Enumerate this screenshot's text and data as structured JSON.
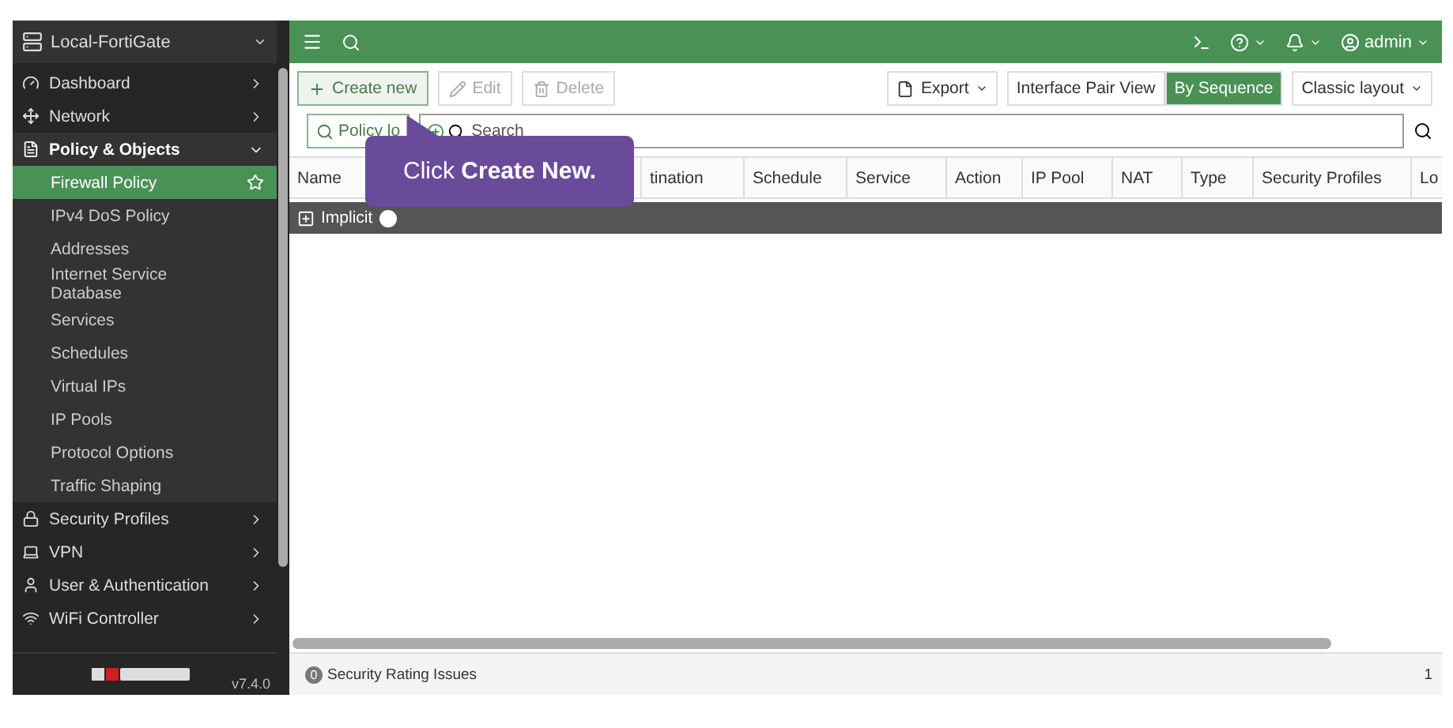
{
  "device": {
    "name": "Local-FortiGate"
  },
  "sidebar": {
    "items": [
      {
        "kind": "section",
        "label": "Dashboard",
        "expanded": false,
        "selected": false
      },
      {
        "kind": "section",
        "label": "Network",
        "expanded": false,
        "selected": false
      },
      {
        "kind": "section",
        "label": "Policy & Objects",
        "expanded": true,
        "selected": true
      },
      {
        "kind": "sub",
        "label": "Firewall Policy",
        "selected": true
      },
      {
        "kind": "sub",
        "label": "IPv4 DoS Policy",
        "selected": false
      },
      {
        "kind": "sub",
        "label": "Addresses",
        "selected": false
      },
      {
        "kind": "sub",
        "label": "Internet Service Database",
        "selected": false
      },
      {
        "kind": "sub",
        "label": "Services",
        "selected": false
      },
      {
        "kind": "sub",
        "label": "Schedules",
        "selected": false
      },
      {
        "kind": "sub",
        "label": "Virtual IPs",
        "selected": false
      },
      {
        "kind": "sub",
        "label": "IP Pools",
        "selected": false
      },
      {
        "kind": "sub",
        "label": "Protocol Options",
        "selected": false
      },
      {
        "kind": "sub",
        "label": "Traffic Shaping",
        "selected": false
      },
      {
        "kind": "section",
        "label": "Security Profiles",
        "expanded": false,
        "selected": false
      },
      {
        "kind": "section",
        "label": "VPN",
        "expanded": false,
        "selected": false
      },
      {
        "kind": "section",
        "label": "User & Authentication",
        "expanded": false,
        "selected": false
      },
      {
        "kind": "section",
        "label": "WiFi Controller",
        "expanded": false,
        "selected": false
      }
    ],
    "version": "v7.4.0"
  },
  "topbar": {
    "user": "admin"
  },
  "toolbar": {
    "buttons": [
      {
        "kind": "create",
        "label": "Create new",
        "disabled": false
      },
      {
        "kind": "edit",
        "label": "Edit",
        "disabled": true
      },
      {
        "kind": "delete",
        "label": "Delete",
        "disabled": true
      }
    ],
    "export": "Export",
    "views": [
      {
        "label": "Interface Pair View",
        "selected": false
      },
      {
        "label": "By Sequence",
        "selected": true
      }
    ],
    "layout": "Classic layout"
  },
  "search": {
    "lookup": "Policy lo",
    "placeholder": "Search"
  },
  "table": {
    "columns": [
      "Name",
      "tination",
      "Schedule",
      "Service",
      "Action",
      "IP Pool",
      "NAT",
      "Type",
      "Security Profiles",
      "Lo"
    ],
    "groups": [
      {
        "label": "Implicit",
        "expanded": false
      }
    ]
  },
  "tooltip": {
    "prefix": "Click ",
    "emphasis": "Create New."
  },
  "status_bar": {
    "badge": "0",
    "label": "Security Rating Issues",
    "count": "1"
  }
}
